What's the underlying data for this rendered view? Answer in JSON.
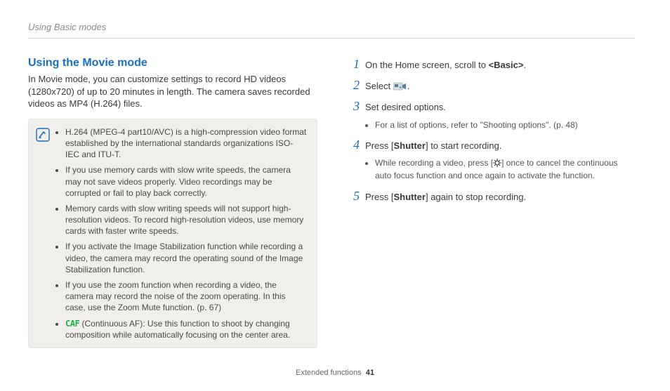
{
  "header": {
    "breadcrumb": "Using Basic modes"
  },
  "left": {
    "title": "Using the Movie mode",
    "intro": "In Movie mode, you can customize settings to record HD videos (1280x720) of up to 20 minutes in length. The camera saves recorded videos as MP4 (H.264) files.",
    "notes": [
      "H.264 (MPEG-4 part10/AVC) is a high-compression video format established by the international standards organizations ISO-IEC and ITU-T.",
      "If you use memory cards with slow write speeds, the camera may not save videos properly. Video recordings may be corrupted or fail to play back correctly.",
      "Memory cards with slow writing speeds will not support high-resolution videos. To record high-resolution videos, use memory cards with faster write speeds.",
      "If you activate the Image Stabilization function while recording a video, the camera may record the operating sound of the Image Stabilization function.",
      "If you use the zoom function when recording a video, the camera may record the noise of the zoom operating. In this case, use the Zoom Mute function. (p. 67)"
    ],
    "caf_label": "CAF",
    "caf_text": " (Continuous AF): Use this function to shoot by changing composition while automatically focusing on the center area."
  },
  "right": {
    "step1_a": "On the Home screen, scroll to ",
    "step1_b": "<Basic>",
    "step1_c": ".",
    "step2_a": "Select ",
    "step2_b": ".",
    "step3": "Set desired options.",
    "step3_sub": "For a list of options, refer to \"Shooting options\". (p. 48)",
    "step4_a": "Press [",
    "step4_b": "Shutter",
    "step4_c": "] to start recording.",
    "step4_sub_a": "While recording a video, press [",
    "step4_sub_b": "] once to cancel the continuous auto focus function and once again to activate the function.",
    "step5_a": "Press [",
    "step5_b": "Shutter",
    "step5_c": "] again to stop recording."
  },
  "footer": {
    "section": "Extended functions",
    "page": "41"
  }
}
